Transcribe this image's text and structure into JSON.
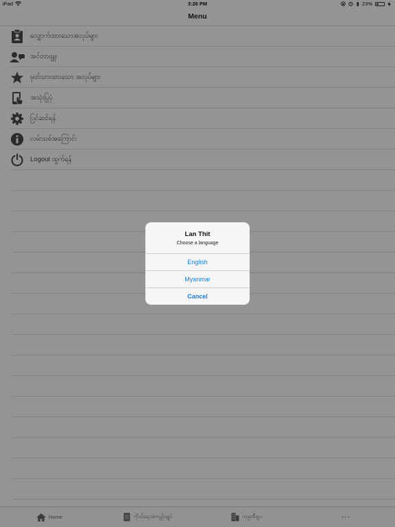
{
  "status_bar": {
    "device": "iPad",
    "time": "3:26 PM",
    "battery": "23%",
    "battery_level": 0.23
  },
  "nav": {
    "title": "Menu"
  },
  "menu": {
    "items": [
      {
        "label": "လျှောက်ထားသောအလုပ်များ",
        "icon": "clipboard-user-icon"
      },
      {
        "label": "အင်တာဗျူး",
        "icon": "interview-chat-icon"
      },
      {
        "label": "မှတ်သားထားသော အလုပ်များ",
        "icon": "star-icon"
      },
      {
        "label": "အသုံးပြုပုံ",
        "icon": "phone-hand-icon"
      },
      {
        "label": "ပြင်ဆင်ရန်",
        "icon": "gear-icon"
      },
      {
        "label": "လမ်းသစ်အကြောင်း",
        "icon": "info-icon"
      },
      {
        "label": "Logout ထွက်ရန်",
        "icon": "power-icon"
      }
    ]
  },
  "tab_bar": {
    "tabs": [
      {
        "label": "Home",
        "icon": "home-icon"
      },
      {
        "label": "ကိုယ်ရေးအကျဉ်းချုပ်",
        "icon": "document-icon"
      },
      {
        "label": "ကုမ္ပဏီများ",
        "icon": "building-icon"
      },
      {
        "label": "• • •",
        "icon": "more-icon"
      }
    ]
  },
  "alert": {
    "title": "Lan Thit",
    "message": "Choose a language",
    "buttons": [
      "English",
      "Myanmar",
      "Cancel"
    ]
  },
  "colors": {
    "accent": "#1a7ce0",
    "icon": "#4a4a4a",
    "overlay": "rgba(0,0,0,0.4)"
  }
}
